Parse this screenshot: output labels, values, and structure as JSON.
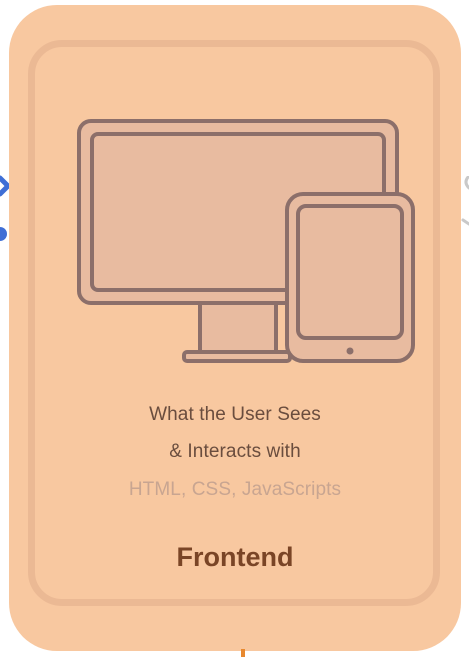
{
  "card": {
    "description_line1": "What the User Sees",
    "description_line2": "& Interacts with",
    "technologies": "HTML, CSS, JavaScripts",
    "title": "Frontend"
  },
  "colors": {
    "card_fill": "#f8c8a0",
    "card_border": "#ebb994",
    "device_stroke": "#8c6f6a",
    "device_fill": "#e8bba0",
    "connector": "#3f6fd6",
    "title": "#7a4526",
    "text": "#6a4d3e",
    "muted_text": "#c8a591"
  },
  "icons": [
    "desktop-monitor-icon",
    "tablet-icon"
  ]
}
